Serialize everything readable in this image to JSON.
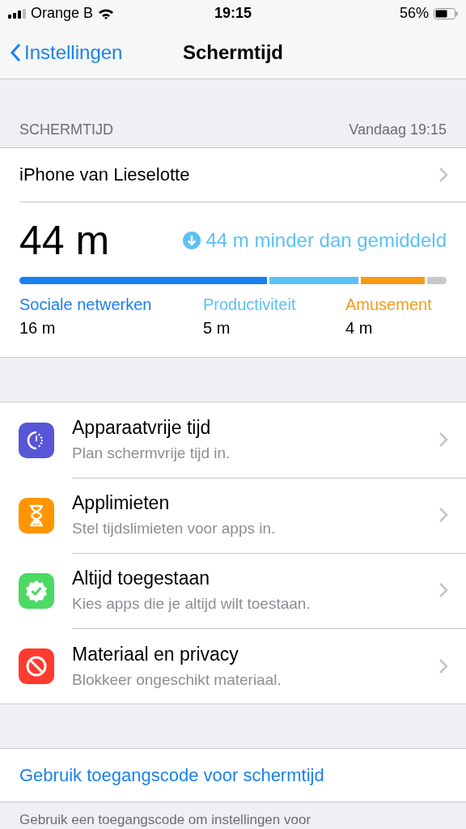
{
  "status_bar": {
    "carrier": "Orange B",
    "time": "19:15",
    "battery": "56%"
  },
  "nav": {
    "back": "Instellingen",
    "title": "Schermtijd"
  },
  "section_header": {
    "title": "SCHERMTIJD",
    "date": "Vandaag 19:15"
  },
  "device": {
    "name": "iPhone van Lieselotte"
  },
  "summary": {
    "total": "44 m",
    "comparison": "44 m minder dan gemiddeld",
    "usage_bar": [
      {
        "color": "#1a7ff0"
      },
      {
        "color": "#5ac2f5"
      },
      {
        "color": "#f59a14"
      },
      {
        "color": "#c7c7cc"
      }
    ],
    "categories": [
      {
        "label": "Sociale netwerken",
        "time": "16 m",
        "color": "#1a7ff0"
      },
      {
        "label": "Productiviteit",
        "time": "5 m",
        "color": "#5ac2f5"
      },
      {
        "label": "Amusement",
        "time": "4 m",
        "color": "#f59a14"
      }
    ]
  },
  "options": [
    {
      "kind": "downtime",
      "color": "#5856d6",
      "title": "Apparaatvrije tijd",
      "subtitle": "Plan schermvrije tijd in."
    },
    {
      "kind": "limits",
      "color": "#ff9500",
      "title": "Applimieten",
      "subtitle": "Stel tijdslimieten voor apps in."
    },
    {
      "kind": "allowed",
      "color": "#4cd964",
      "title": "Altijd toegestaan",
      "subtitle": "Kies apps die je altijd wilt toestaan."
    },
    {
      "kind": "restrictions",
      "color": "#ff3b30",
      "title": "Materiaal en privacy",
      "subtitle": "Blokkeer ongeschikt materiaal."
    }
  ],
  "passcode_link": "Gebruik toegangscode voor schermtijd",
  "footer": "Gebruik een toegangscode om instellingen voor"
}
